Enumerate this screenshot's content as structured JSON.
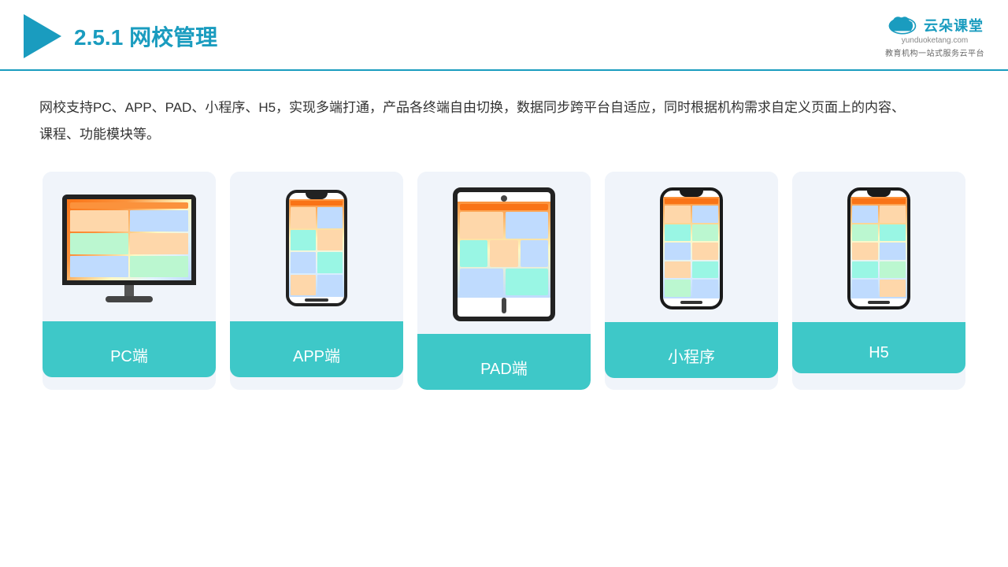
{
  "header": {
    "title_prefix": "2.5.1",
    "title_main": "网校管理",
    "brand_name": "云朵课堂",
    "brand_url": "yunduoketang.com",
    "brand_tagline": "教育机构一站式服务云平台"
  },
  "description": {
    "text": "网校支持PC、APP、PAD、小程序、H5，实现多端打通，产品各终端自由切换，数据同步跨平台自适应，同时根据机构需求自定义页面上的内容、课程、功能模块等。"
  },
  "cards": [
    {
      "label": "PC端",
      "id": "pc"
    },
    {
      "label": "APP端",
      "id": "app"
    },
    {
      "label": "PAD端",
      "id": "pad"
    },
    {
      "label": "小程序",
      "id": "miniapp"
    },
    {
      "label": "H5",
      "id": "h5"
    }
  ],
  "colors": {
    "accent": "#1a9cbf",
    "teal": "#3ec8c8",
    "card_bg": "#f0f4fa"
  }
}
